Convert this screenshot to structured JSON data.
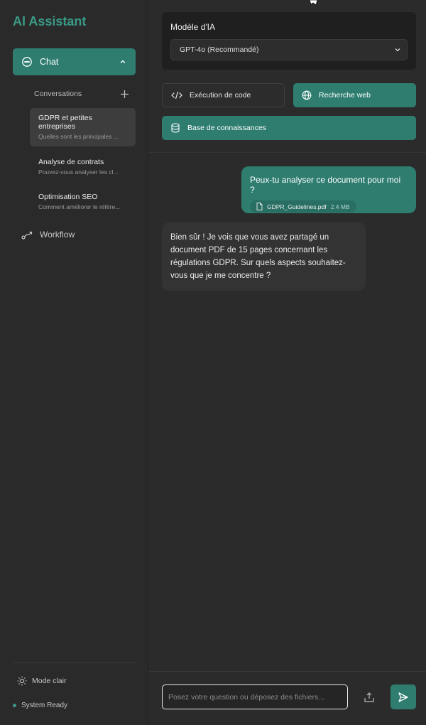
{
  "app": {
    "title": "AI Assistant"
  },
  "sidebar": {
    "chat_label": "Chat",
    "conversations_label": "Conversations",
    "conversations": [
      {
        "title": "GDPR et petites entreprises",
        "preview": "Quelles sont les principales ..."
      },
      {
        "title": "Analyse de contrats",
        "preview": "Pouvez-vous analyser les cl..."
      },
      {
        "title": "Optimisation SEO",
        "preview": "Comment améliorer le référe..."
      }
    ],
    "workflow_label": "Workflow",
    "mode_label": "Mode clair",
    "status_label": "System Ready"
  },
  "model": {
    "label": "Modèle d'IA",
    "selected": "GPT-4o (Recommandé)"
  },
  "tools": {
    "code_exec": "Exécution de code",
    "web_search": "Recherche web",
    "knowledge_base": "Base de connaissances"
  },
  "messages": {
    "user": {
      "text": "Peux-tu analyser ce document pour moi ?",
      "file_name": "GDPR_Guidelines.pdf",
      "file_size": "2.4 MB"
    },
    "assistant": {
      "text": "Bien sûr ! Je vois que vous avez partagé un document PDF de 15 pages concernant les régulations GDPR. Sur quels aspects souhaitez-vous que je me concentre ?"
    }
  },
  "composer": {
    "placeholder": "Posez votre question ou déposez des fichiers..."
  },
  "colors": {
    "accent": "#2e7d6f",
    "accent_text": "#3a9a86",
    "background": "#2b2b2b",
    "card": "#1f1f1f"
  }
}
